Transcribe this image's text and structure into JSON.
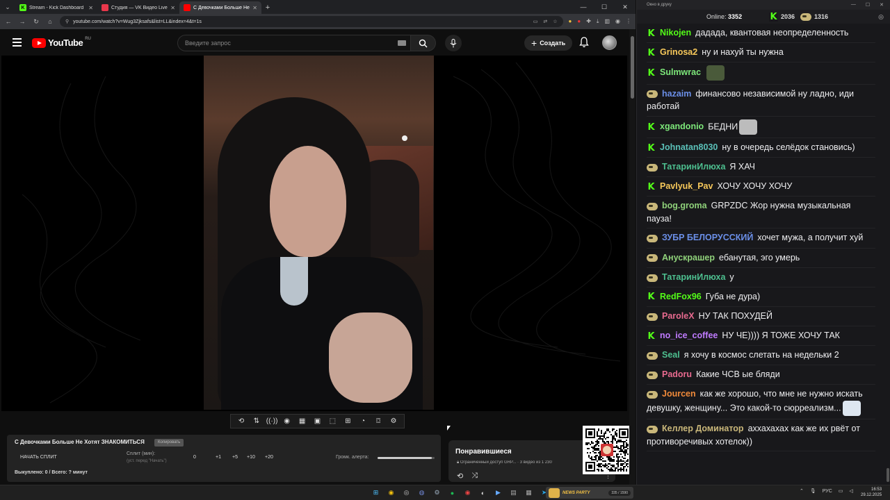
{
  "browser": {
    "tabs": [
      {
        "title": "Stream - Kick Dashboard",
        "favicon_color": "#53fc18",
        "favicon_glyph": "K",
        "active": false
      },
      {
        "title": "Студия — VK Видео Live",
        "favicon_color": "#e8374b",
        "favicon_glyph": "",
        "active": false
      },
      {
        "title": "С Девочками Больше Не Хотят ЗНАКОМИТЬСЯ",
        "favicon_color": "#ff0000",
        "favicon_glyph": "",
        "active": true
      }
    ],
    "url": "youtube.com/watch?v=Wug3Zjksafs&list=LL&index=4&t=1s"
  },
  "youtube": {
    "logo_word": "YouTube",
    "country": "RU",
    "search_placeholder": "Введите запрос",
    "create_label": "Создать"
  },
  "extension": {
    "video_title": "С Девочками Больше Не Хотят ЗНАКОМИТЬСЯ",
    "chip": "Копировать",
    "start_split": "НАЧАТЬ СПЛИТ",
    "split_label": "Сплит (мин):",
    "split_hint": "(уст. перед \"Начать\")",
    "split_values": [
      "0",
      "+1",
      "+5",
      "+10",
      "+20"
    ],
    "alert_volume_label": "Громк. алерта:",
    "alert_volume": 0.95,
    "bought": "Выкуплено: 0 / Всего: ? минут"
  },
  "liked": {
    "title": "Понравившиеся",
    "subtitle": "Ограниченный доступ  GRP... · 3 видео из 1 230"
  },
  "chat": {
    "window_title": "Окно в друку",
    "online_label": "Online:",
    "online_count": "3352",
    "kick_count": "2036",
    "vk_count": "1316",
    "messages": [
      {
        "platform": "kick",
        "user": "Nikojen",
        "color": "#53fc18",
        "text": "дадада, квантовая неопределенность",
        "emote": ""
      },
      {
        "platform": "kick",
        "user": "Grinosa2",
        "color": "#f7c85a",
        "text": "ну и нахуй ты нужна",
        "emote": ""
      },
      {
        "platform": "kick",
        "user": "Sulmwrac",
        "color": "#7de87a",
        "text": "",
        "emote": "#4a5a3a"
      },
      {
        "platform": "vk",
        "user": "hazaim",
        "color": "#6b8fe8",
        "text": "финансово независимой ну ладно, иди работай",
        "emote": ""
      },
      {
        "platform": "kick",
        "user": "xgandonio",
        "color": "#7de87a",
        "text": "БЕДНИ",
        "emote": "#bcbcbc"
      },
      {
        "platform": "kick",
        "user": "Johnatan8030",
        "color": "#5bc0b8",
        "text": "ну в очередь селёдок становись)",
        "emote": ""
      },
      {
        "platform": "vk",
        "user": "ТатаринИлюха",
        "color": "#4dbf8f",
        "text": "Я ХАЧ",
        "emote": ""
      },
      {
        "platform": "kick",
        "user": "Pavlyuk_Pav",
        "color": "#f7c85a",
        "text": "ХОЧУ ХОЧУ ХОЧУ",
        "emote": ""
      },
      {
        "platform": "vk",
        "user": "bog.groma",
        "color": "#8fd17a",
        "text": "GRPZDC Жор нужна музыкальная пауза!",
        "emote": ""
      },
      {
        "platform": "vk",
        "user": "ЗУБР БЕЛОРУССКИЙ",
        "color": "#6b8fe8",
        "text": "хочет мужа, а получит хуй",
        "emote": ""
      },
      {
        "platform": "vk",
        "user": "Анускрашер",
        "color": "#8fd17a",
        "text": "ебанутая, эго умерь",
        "emote": ""
      },
      {
        "platform": "vk",
        "user": "ТатаринИлюха",
        "color": "#4dbf8f",
        "text": "у",
        "emote": ""
      },
      {
        "platform": "kick",
        "user": "RedFox96",
        "color": "#53fc18",
        "text": "Губа не дура)",
        "emote": ""
      },
      {
        "platform": "vk",
        "user": "ParoleX",
        "color": "#e86a8f",
        "text": "НУ ТАК ПОХУДЕЙ",
        "emote": ""
      },
      {
        "platform": "kick",
        "user": "no_ice_coffee",
        "color": "#c07bff",
        "text": "НУ ЧЕ)))) Я ТОЖЕ ХОЧУ ТАК",
        "emote": ""
      },
      {
        "platform": "vk",
        "user": "Seal",
        "color": "#4dbf8f",
        "text": "я хочу в космос слетать на недельки 2",
        "emote": ""
      },
      {
        "platform": "vk",
        "user": "Padoru",
        "color": "#e86a8f",
        "text": "Какие ЧСВ ые бляди",
        "emote": ""
      },
      {
        "platform": "vk",
        "user": "Jourcen",
        "color": "#f08a3a",
        "text": "как же хорошо, что мне не нужно искать девушку, женщину... Это какой-то сюрреализм...",
        "emote": "#dde6f0"
      },
      {
        "platform": "vk",
        "user": "Келлер Доминатор",
        "color": "#c9b77a",
        "text": "аххахахах как же их рвёт от противоречивых хотелок))",
        "emote": ""
      }
    ]
  },
  "taskbar": {
    "news_title": "NEWS PARTY",
    "news_progress": "335 / 1590",
    "lang": "РУС",
    "time": "16:53",
    "date": "29.12.2025"
  }
}
